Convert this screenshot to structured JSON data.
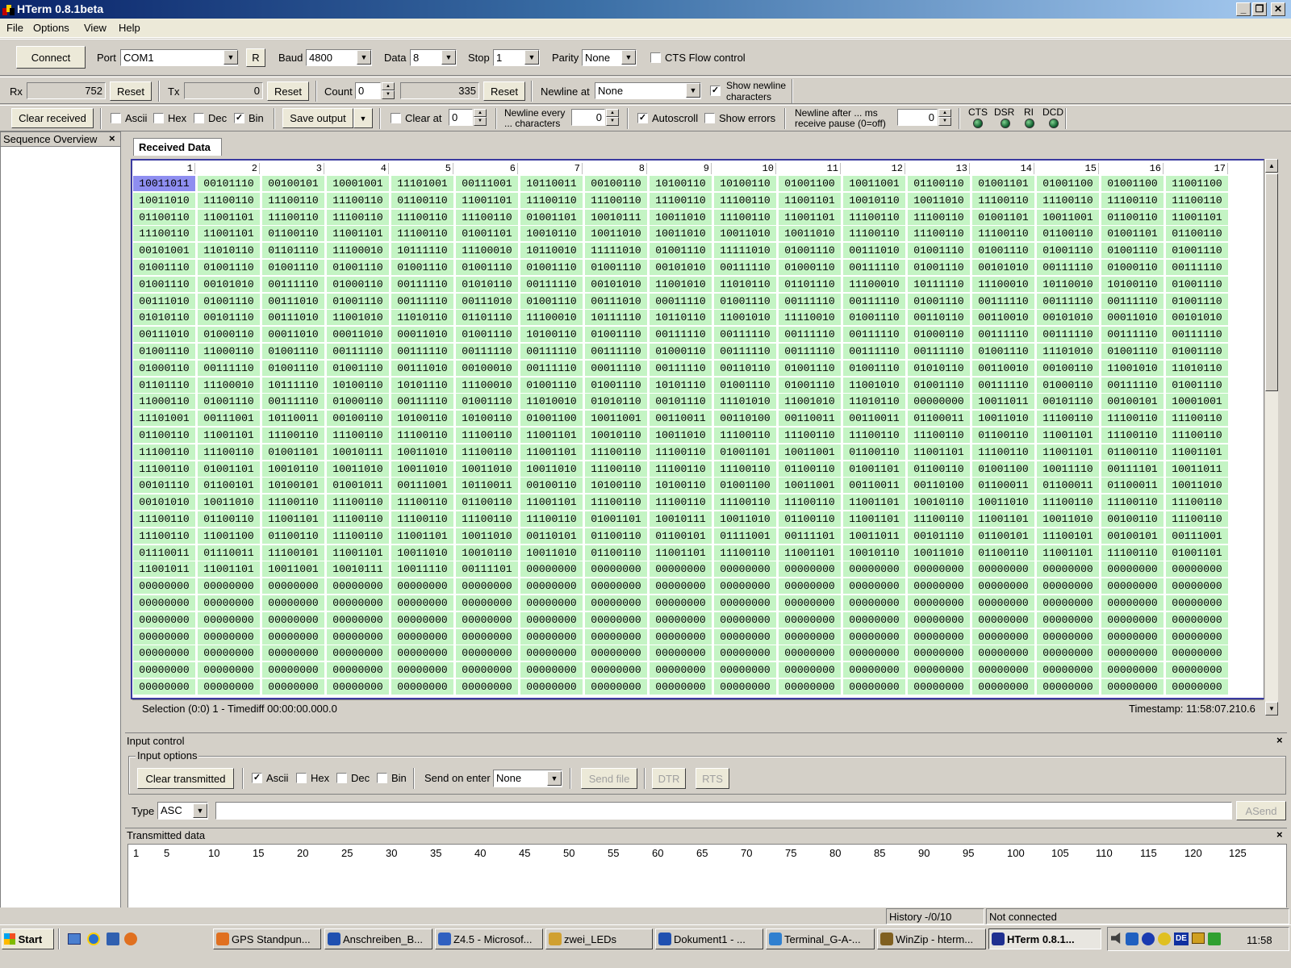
{
  "window": {
    "title": "HTerm 0.8.1beta"
  },
  "menu": [
    "File",
    "Options",
    "View",
    "Help"
  ],
  "toolbar1": {
    "connect": "Connect",
    "port_label": "Port",
    "port_value": "COM1",
    "r_button": "R",
    "baud_label": "Baud",
    "baud_value": "4800",
    "data_label": "Data",
    "data_value": "8",
    "stop_label": "Stop",
    "stop_value": "1",
    "parity_label": "Parity",
    "parity_value": "None",
    "cts_label": "CTS Flow control"
  },
  "toolbar2": {
    "rx_label": "Rx",
    "rx_value": "752",
    "rx_reset": "Reset",
    "tx_label": "Tx",
    "tx_value": "0",
    "tx_reset": "Reset",
    "count_label": "Count",
    "count_value": "0",
    "count_total": "335",
    "count_reset": "Reset",
    "newline_label": "Newline at",
    "newline_value": "None",
    "show_newline_1": "Show newline",
    "show_newline_2": "characters"
  },
  "toolbar3": {
    "clear_received": "Clear received",
    "ascii": "Ascii",
    "hex": "Hex",
    "dec": "Dec",
    "bin": "Bin",
    "save_output": "Save output",
    "clear_at": "Clear at",
    "clear_at_value": "0",
    "newline_every_1": "Newline every",
    "newline_every_2": "... characters",
    "newline_every_value": "0",
    "autoscroll": "Autoscroll",
    "show_errors": "Show errors",
    "newline_after_1": "Newline after ... ms",
    "newline_after_2": "receive pause (0=off)",
    "newline_after_value": "0",
    "cts": "CTS",
    "dsr": "DSR",
    "ri": "RI",
    "dcd": "DCD"
  },
  "sequence_overview": {
    "title": "Sequence Overview",
    "close": "×"
  },
  "received": {
    "tab": "Received Data",
    "columns": [
      "1",
      "2",
      "3",
      "4",
      "5",
      "6",
      "7",
      "8",
      "9",
      "10",
      "11",
      "12",
      "13",
      "14",
      "15",
      "16",
      "17"
    ],
    "rows": [
      [
        "10011011",
        "00101110",
        "00100101",
        "10001001",
        "11101001",
        "00111001",
        "10110011",
        "00100110",
        "10100110",
        "10100110",
        "01001100",
        "10011001",
        "01100110",
        "01001101",
        "01001100",
        "01001100",
        "11001100"
      ],
      [
        "10011010",
        "11100110",
        "11100110",
        "11100110",
        "01100110",
        "11001101",
        "11100110",
        "11100110",
        "11100110",
        "11100110",
        "11001101",
        "10010110",
        "10011010",
        "11100110",
        "11100110",
        "11100110",
        "11100110"
      ],
      [
        "01100110",
        "11001101",
        "11100110",
        "11100110",
        "11100110",
        "11100110",
        "01001101",
        "10010111",
        "10011010",
        "11100110",
        "11001101",
        "11100110",
        "11100110",
        "01001101",
        "10011001",
        "01100110",
        "11001101"
      ],
      [
        "11100110",
        "11001101",
        "01100110",
        "11001101",
        "11100110",
        "01001101",
        "10010110",
        "10011010",
        "10011010",
        "10011010",
        "10011010",
        "11100110",
        "11100110",
        "11100110",
        "01100110",
        "01001101",
        "01100110"
      ],
      [
        "00101001",
        "11010110",
        "01101110",
        "11100010",
        "10111110",
        "11100010",
        "10110010",
        "11111010",
        "01001110",
        "11111010",
        "01001110",
        "00111010",
        "01001110",
        "01001110",
        "01001110",
        "01001110",
        "01001110"
      ],
      [
        "01001110",
        "01001110",
        "01001110",
        "01001110",
        "01001110",
        "01001110",
        "01001110",
        "01001110",
        "00101010",
        "00111110",
        "01000110",
        "00111110",
        "01001110",
        "00101010",
        "00111110",
        "01000110",
        "00111110"
      ],
      [
        "01001110",
        "00101010",
        "00111110",
        "01000110",
        "00111110",
        "01010110",
        "00111110",
        "00101010",
        "11001010",
        "11010110",
        "01101110",
        "11100010",
        "10111110",
        "11100010",
        "10110010",
        "10100110",
        "01001110"
      ],
      [
        "00111010",
        "01001110",
        "00111010",
        "01001110",
        "00111110",
        "00111010",
        "01001110",
        "00111010",
        "00011110",
        "01001110",
        "00111110",
        "00111110",
        "01001110",
        "00111110",
        "00111110",
        "00111110",
        "01001110"
      ],
      [
        "01010110",
        "00101110",
        "00111010",
        "11001010",
        "11010110",
        "01101110",
        "11100010",
        "10111110",
        "10110110",
        "11001010",
        "11110010",
        "01001110",
        "00110110",
        "00110010",
        "00101010",
        "00011010",
        "00101010"
      ],
      [
        "00111010",
        "01000110",
        "00011010",
        "00011010",
        "00011010",
        "01001110",
        "10100110",
        "01001110",
        "00111110",
        "00111110",
        "00111110",
        "00111110",
        "01000110",
        "00111110",
        "00111110",
        "00111110",
        "00111110"
      ],
      [
        "01001110",
        "11000110",
        "01001110",
        "00111110",
        "00111110",
        "00111110",
        "00111110",
        "00111110",
        "01000110",
        "00111110",
        "00111110",
        "00111110",
        "00111110",
        "01001110",
        "11101010",
        "01001110",
        "01001110"
      ],
      [
        "01000110",
        "00111110",
        "01001110",
        "01001110",
        "00111010",
        "00100010",
        "00111110",
        "00011110",
        "00111110",
        "00110110",
        "01001110",
        "01001110",
        "01010110",
        "00110010",
        "00100110",
        "11001010",
        "11010110"
      ],
      [
        "01101110",
        "11100010",
        "10111110",
        "10100110",
        "10101110",
        "11100010",
        "01001110",
        "01001110",
        "10101110",
        "01001110",
        "01001110",
        "11001010",
        "01001110",
        "00111110",
        "01000110",
        "00111110",
        "01001110"
      ],
      [
        "11000110",
        "01001110",
        "00111110",
        "01000110",
        "00111110",
        "01001110",
        "11010010",
        "01010110",
        "00101110",
        "11101010",
        "11001010",
        "11010110",
        "00000000",
        "10011011",
        "00101110",
        "00100101",
        "10001001"
      ],
      [
        "11101001",
        "00111001",
        "10110011",
        "00100110",
        "10100110",
        "10100110",
        "01001100",
        "10011001",
        "00110011",
        "00110100",
        "00110011",
        "00110011",
        "01100011",
        "10011010",
        "11100110",
        "11100110",
        "11100110"
      ],
      [
        "01100110",
        "11001101",
        "11100110",
        "11100110",
        "11100110",
        "11100110",
        "11001101",
        "10010110",
        "10011010",
        "11100110",
        "11100110",
        "11100110",
        "11100110",
        "01100110",
        "11001101",
        "11100110",
        "11100110"
      ],
      [
        "11100110",
        "11100110",
        "01001101",
        "10010111",
        "10011010",
        "11100110",
        "11001101",
        "11100110",
        "11100110",
        "01001101",
        "10011001",
        "01100110",
        "11001101",
        "11100110",
        "11001101",
        "01100110",
        "11001101"
      ],
      [
        "11100110",
        "01001101",
        "10010110",
        "10011010",
        "10011010",
        "10011010",
        "10011010",
        "11100110",
        "11100110",
        "11100110",
        "01100110",
        "01001101",
        "01100110",
        "01001100",
        "10011110",
        "00111101",
        "10011011"
      ],
      [
        "00101110",
        "01100101",
        "10100101",
        "01001011",
        "00111001",
        "10110011",
        "00100110",
        "10100110",
        "10100110",
        "01001100",
        "10011001",
        "00110011",
        "00110100",
        "01100011",
        "01100011",
        "01100011",
        "10011010"
      ],
      [
        "00101010",
        "10011010",
        "11100110",
        "11100110",
        "11100110",
        "01100110",
        "11001101",
        "11100110",
        "11100110",
        "11100110",
        "11100110",
        "11001101",
        "10010110",
        "10011010",
        "11100110",
        "11100110",
        "11100110"
      ],
      [
        "11100110",
        "01100110",
        "11001101",
        "11100110",
        "11100110",
        "11100110",
        "11100110",
        "01001101",
        "10010111",
        "10011010",
        "01100110",
        "11001101",
        "11100110",
        "11001101",
        "10011010",
        "00100110",
        "11100110"
      ],
      [
        "11100110",
        "11001100",
        "01100110",
        "11100110",
        "11001101",
        "10011010",
        "00110101",
        "01100110",
        "01100101",
        "01111001",
        "00111101",
        "10011011",
        "00101110",
        "01100101",
        "11100101",
        "00100101",
        "00111001"
      ],
      [
        "01110011",
        "01110011",
        "11100101",
        "11001101",
        "10011010",
        "10010110",
        "10011010",
        "01100110",
        "11001101",
        "11100110",
        "11001101",
        "10010110",
        "10011010",
        "01100110",
        "11001101",
        "11100110",
        "01001101"
      ],
      [
        "11001011",
        "11001101",
        "10011001",
        "10010111",
        "10011110",
        "00111101",
        "00000000",
        "00000000",
        "00000000",
        "00000000",
        "00000000",
        "00000000",
        "00000000",
        "00000000",
        "00000000",
        "00000000",
        "00000000"
      ],
      [
        "00000000",
        "00000000",
        "00000000",
        "00000000",
        "00000000",
        "00000000",
        "00000000",
        "00000000",
        "00000000",
        "00000000",
        "00000000",
        "00000000",
        "00000000",
        "00000000",
        "00000000",
        "00000000",
        "00000000"
      ],
      [
        "00000000",
        "00000000",
        "00000000",
        "00000000",
        "00000000",
        "00000000",
        "00000000",
        "00000000",
        "00000000",
        "00000000",
        "00000000",
        "00000000",
        "00000000",
        "00000000",
        "00000000",
        "00000000",
        "00000000"
      ],
      [
        "00000000",
        "00000000",
        "00000000",
        "00000000",
        "00000000",
        "00000000",
        "00000000",
        "00000000",
        "00000000",
        "00000000",
        "00000000",
        "00000000",
        "00000000",
        "00000000",
        "00000000",
        "00000000",
        "00000000"
      ],
      [
        "00000000",
        "00000000",
        "00000000",
        "00000000",
        "00000000",
        "00000000",
        "00000000",
        "00000000",
        "00000000",
        "00000000",
        "00000000",
        "00000000",
        "00000000",
        "00000000",
        "00000000",
        "00000000",
        "00000000"
      ],
      [
        "00000000",
        "00000000",
        "00000000",
        "00000000",
        "00000000",
        "00000000",
        "00000000",
        "00000000",
        "00000000",
        "00000000",
        "00000000",
        "00000000",
        "00000000",
        "00000000",
        "00000000",
        "00000000",
        "00000000"
      ],
      [
        "00000000",
        "00000000",
        "00000000",
        "00000000",
        "00000000",
        "00000000",
        "00000000",
        "00000000",
        "00000000",
        "00000000",
        "00000000",
        "00000000",
        "00000000",
        "00000000",
        "00000000",
        "00000000",
        "00000000"
      ],
      [
        "00000000",
        "00000000",
        "00000000",
        "00000000",
        "00000000",
        "00000000",
        "00000000",
        "00000000",
        "00000000",
        "00000000",
        "00000000",
        "00000000",
        "00000000",
        "00000000",
        "00000000",
        "00000000",
        "00000000"
      ]
    ],
    "selection": "Selection (0:0) 1  -  Timediff 00:00:00.000.0",
    "timestamp": "Timestamp: 11:58:07.210.6"
  },
  "input_control": {
    "title": "Input control",
    "close": "×",
    "options_title": "Input options",
    "clear_transmitted": "Clear transmitted",
    "ascii": "Ascii",
    "hex": "Hex",
    "dec": "Dec",
    "bin": "Bin",
    "send_on_enter_label": "Send on enter",
    "send_on_enter_value": "None",
    "send_file": "Send file",
    "dtr": "DTR",
    "rts": "RTS",
    "type_label": "Type",
    "type_value": "ASC",
    "input_value": "",
    "asend": "ASend"
  },
  "transmitted": {
    "title": "Transmitted data",
    "close": "×",
    "ruler": [
      "1",
      "5",
      "10",
      "15",
      "20",
      "25",
      "30",
      "35",
      "40",
      "45",
      "50",
      "55",
      "60",
      "65",
      "70",
      "75",
      "80",
      "85",
      "90",
      "95",
      "100",
      "105",
      "110",
      "115",
      "120",
      "125"
    ]
  },
  "status": {
    "history": "History -/0/10",
    "connection": "Not connected"
  },
  "taskbar": {
    "start": "Start",
    "tasks": [
      "GPS Standpun...",
      "Anschreiben_B...",
      "Z4.5 - Microsof...",
      "zwei_LEDs",
      "Dokument1 - ...",
      "Terminal_G-A-...",
      "WinZip - hterm...",
      "HTerm 0.8.1..."
    ],
    "clock": "11:58"
  },
  "icons": {
    "task_colors": [
      "#e07020",
      "#2050b0",
      "#3060c0",
      "#d0a030",
      "#2050b0",
      "#3080d0",
      "#806020",
      "#203090"
    ]
  }
}
